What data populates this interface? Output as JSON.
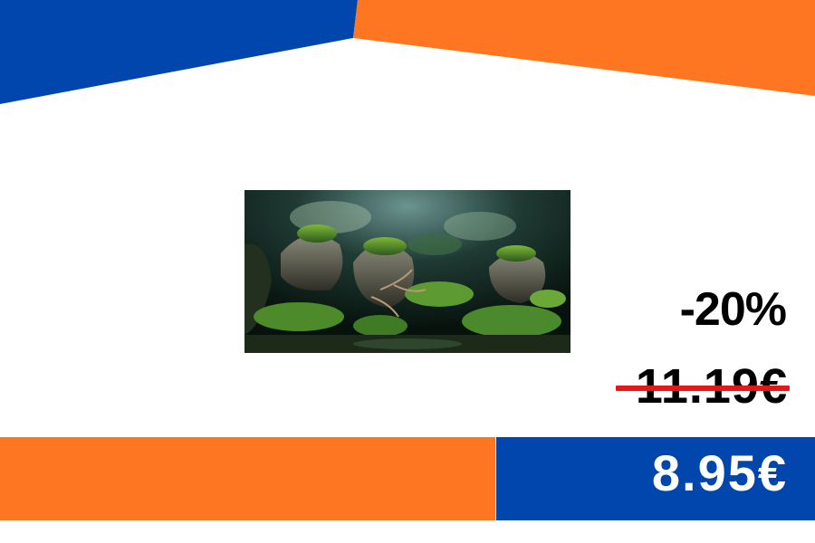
{
  "colors": {
    "brand_blue": "#0046AD",
    "brand_orange": "#FF7622",
    "strike_red": "#E41818"
  },
  "product_image": {
    "icon": "aquarium-background-image"
  },
  "pricing": {
    "discount": "-20%",
    "old_price": "11.19€",
    "new_price": "8.95€"
  }
}
